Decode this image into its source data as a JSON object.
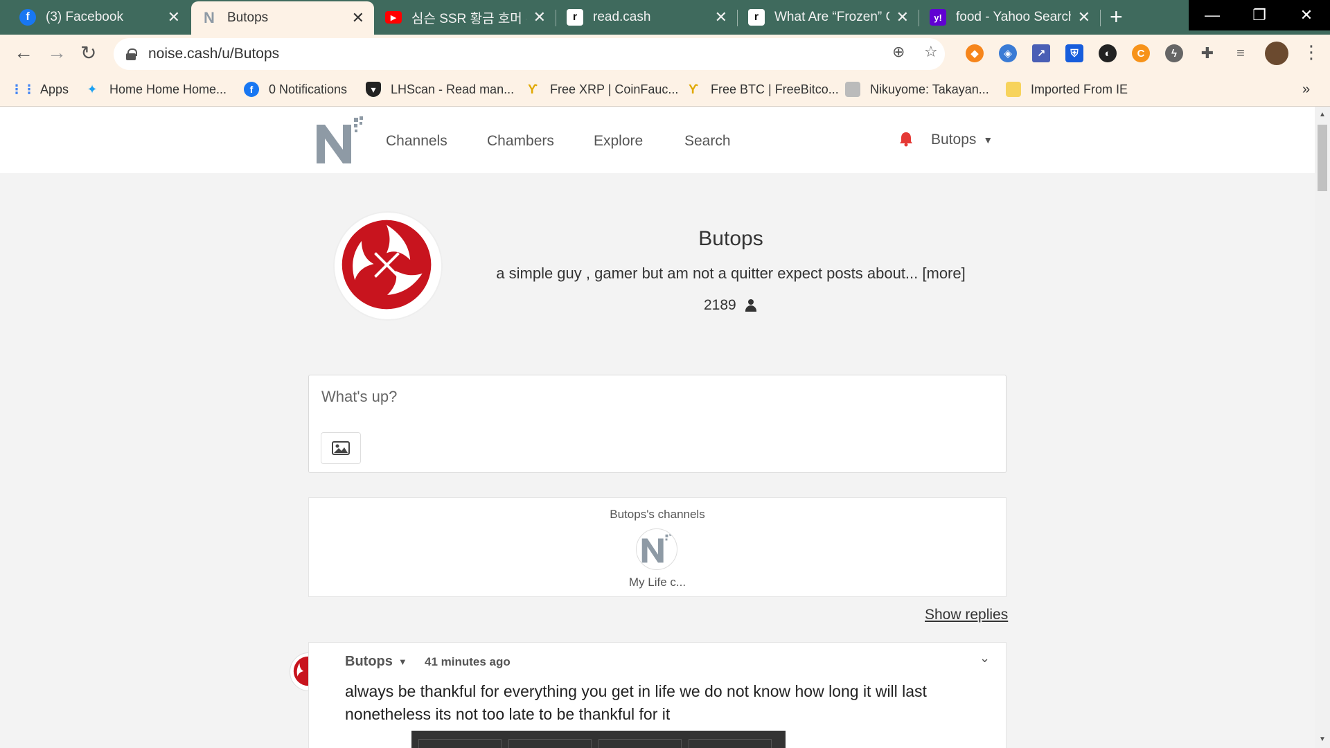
{
  "browser": {
    "tabs": [
      {
        "title": "(3) Facebook",
        "icon": "facebook-icon",
        "color": "#1877f2",
        "glyph": "f"
      },
      {
        "title": "Butops",
        "icon": "noise-cash-icon",
        "color": "#8e9aa5",
        "glyph": "N"
      },
      {
        "title": "심슨 SSR 황금 호머 -",
        "icon": "youtube-icon",
        "color": "#ff0000",
        "glyph": "▶"
      },
      {
        "title": "read.cash",
        "icon": "read-cash-icon",
        "color": "#ffffff",
        "glyph": "r"
      },
      {
        "title": "What Are “Frozen” C",
        "icon": "read-cash-icon",
        "color": "#ffffff",
        "glyph": "r"
      },
      {
        "title": "food - Yahoo Search",
        "icon": "yahoo-icon",
        "color": "#6001d2",
        "glyph": "y!"
      }
    ],
    "new_tab": "+",
    "close_glyph": "✕",
    "window_controls": [
      "—",
      "❐",
      "✕"
    ],
    "url": "noise.cash/u/Butops",
    "bookmarks": [
      {
        "label": "Apps",
        "icon": "apps-grid-icon",
        "color": "#4285f4"
      },
      {
        "label": "Home Home Home...",
        "icon": "twitter-icon",
        "color": "#1da1f2"
      },
      {
        "label": "0 Notifications",
        "icon": "facebook-icon",
        "color": "#1877f2"
      },
      {
        "label": "LHScan - Read man...",
        "icon": "shield-icon",
        "color": "#222222"
      },
      {
        "label": "Free XRP | CoinFauc...",
        "icon": "faucet-icon",
        "color": "#f5c542"
      },
      {
        "label": "Free BTC | FreeBitco...",
        "icon": "faucet-icon",
        "color": "#f5c542"
      },
      {
        "label": "Nikuyome: Takayan...",
        "icon": "manga-icon",
        "color": "#888888"
      },
      {
        "label": "Imported From IE",
        "icon": "folder-icon",
        "color": "#f7d35c"
      }
    ],
    "bookmarks_overflow": "»"
  },
  "site": {
    "nav": [
      "Channels",
      "Chambers",
      "Explore",
      "Search"
    ],
    "user": "Butops",
    "accent": "#e53935"
  },
  "profile": {
    "name": "Butops",
    "bio": "a simple guy , gamer but am not a quitter expect posts about... [more]",
    "followers": "2189"
  },
  "composer": {
    "placeholder": "What's up?"
  },
  "channels": {
    "heading": "Butops's channels",
    "items": [
      {
        "label": "My Life c..."
      }
    ]
  },
  "show_replies": "Show replies",
  "posts": [
    {
      "author": "Butops",
      "time": "41 minutes ago",
      "text": "always be thankful for everything you get in life we do not know how long it will last nonetheless its not too late to be thankful for it"
    }
  ]
}
